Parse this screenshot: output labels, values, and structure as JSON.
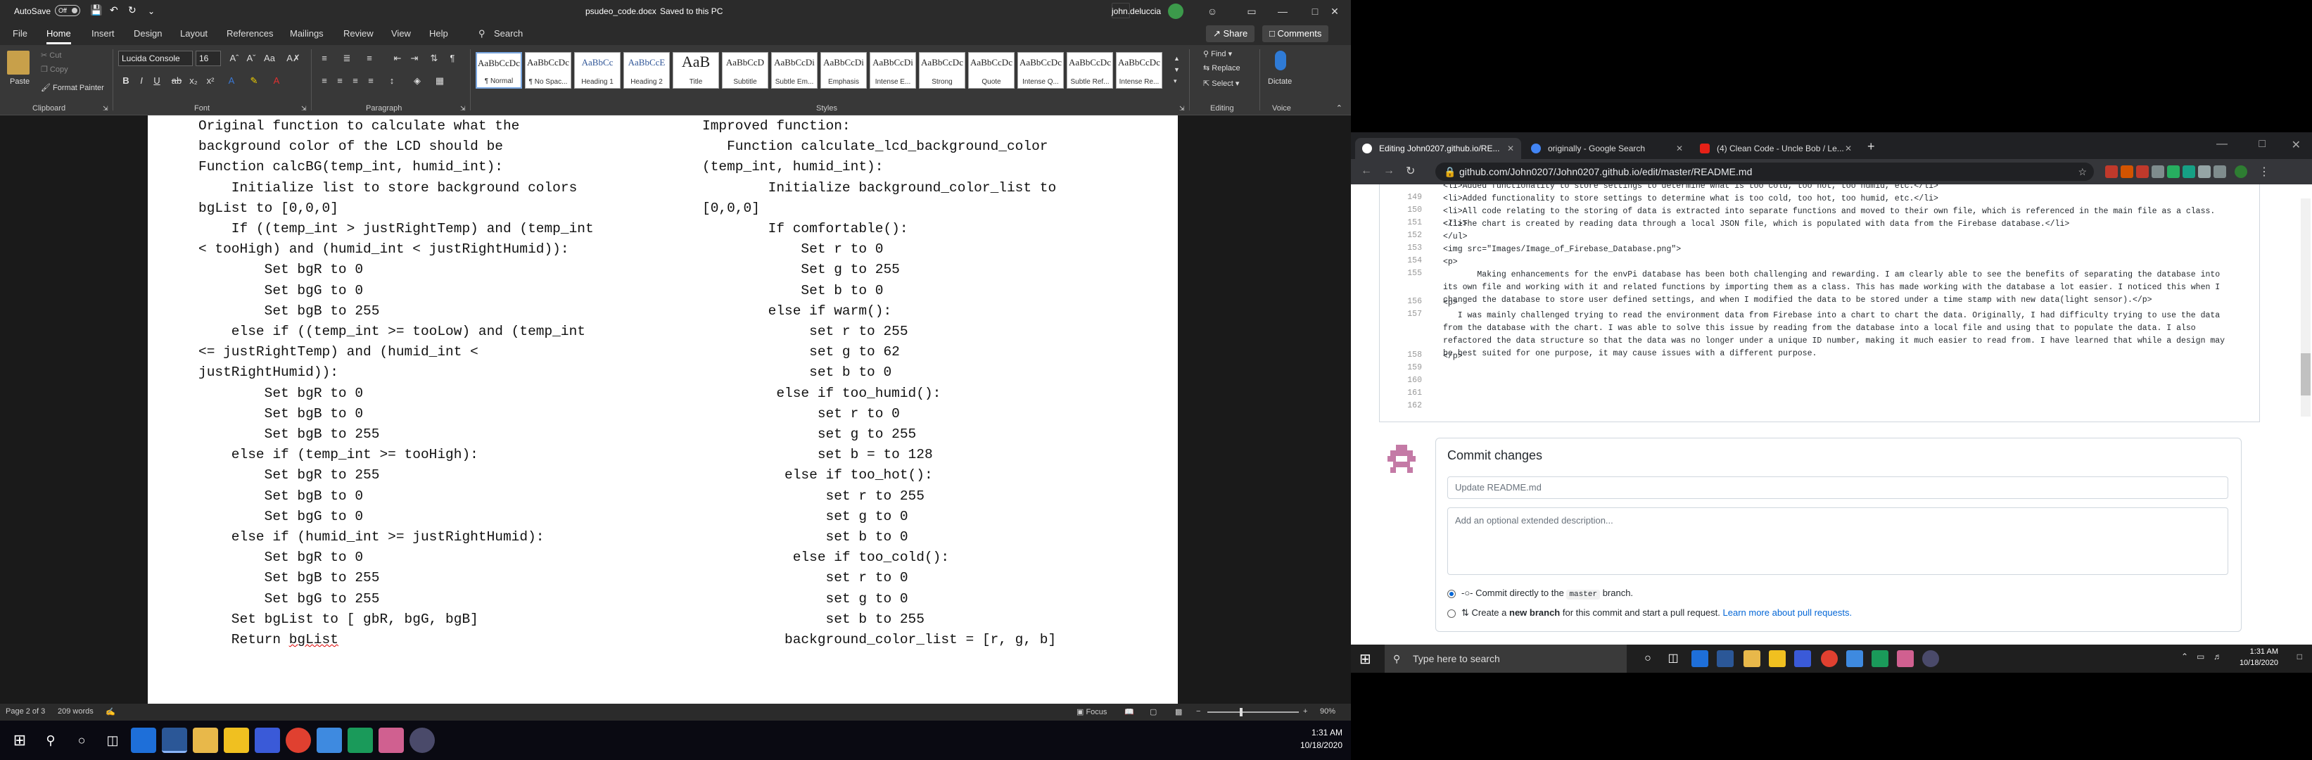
{
  "word": {
    "title_bar": {
      "autosave_label": "AutoSave",
      "autosave_state": "Off",
      "doc_title": "psudeo_code.docx",
      "saved_status": "Saved to this PC",
      "user_name": "john.deluccia"
    },
    "tabs": [
      "File",
      "Home",
      "Insert",
      "Design",
      "Layout",
      "References",
      "Mailings",
      "Review",
      "View",
      "Help"
    ],
    "search_label": "Search",
    "share_label": "Share",
    "comments_label": "Comments",
    "ribbon": {
      "paste_label": "Paste",
      "cut_label": "Cut",
      "copy_label": "Copy",
      "format_painter_label": "Format Painter",
      "font_name": "Lucida Console",
      "font_size": "16",
      "styles": [
        {
          "preview": "AaBbCcDc",
          "name": "¶ Normal"
        },
        {
          "preview": "AaBbCcDc",
          "name": "¶ No Spac..."
        },
        {
          "preview": "AaBbCc",
          "name": "Heading 1"
        },
        {
          "preview": "AaBbCcE",
          "name": "Heading 2"
        },
        {
          "preview": "AaB",
          "name": "Title"
        },
        {
          "preview": "AaBbCcD",
          "name": "Subtitle"
        },
        {
          "preview": "AaBbCcDi",
          "name": "Subtle Em..."
        },
        {
          "preview": "AaBbCcDi",
          "name": "Emphasis"
        },
        {
          "preview": "AaBbCcDi",
          "name": "Intense E..."
        },
        {
          "preview": "AaBbCcDc",
          "name": "Strong"
        },
        {
          "preview": "AaBbCcDc",
          "name": "Quote"
        },
        {
          "preview": "AaBbCcDc",
          "name": "Intense Q..."
        },
        {
          "preview": "AaBbCcDc",
          "name": "Subtle Ref..."
        },
        {
          "preview": "AaBbCcDc",
          "name": "Intense Re..."
        }
      ],
      "find_label": "Find",
      "replace_label": "Replace",
      "select_label": "Select",
      "dictate_label": "Dictate",
      "groups": {
        "clipboard": "Clipboard",
        "font": "Font",
        "paragraph": "Paragraph",
        "styles": "Styles",
        "editing": "Editing",
        "voice": "Voice"
      }
    },
    "page_left": [
      "Original function to calculate what the",
      "background color of the LCD should be",
      "Function calcBG(temp_int, humid_int):",
      "    Initialize list to store background colors",
      "bgList to [0,0,0]",
      "    If ((temp_int > justRightTemp) and (temp_int",
      "< tooHigh) and (humid_int < justRightHumid)):",
      "        Set bgR to 0",
      "        Set bgG to 0",
      "        Set bgB to 255",
      "    else if ((temp_int >= tooLow) and (temp_int",
      "<= justRightTemp) and (humid_int <",
      "justRightHumid)):",
      "        Set bgR to 0",
      "        Set bgB to 0",
      "        Set bgB to 255",
      "    else if (temp_int >= tooHigh):",
      "        Set bgR to 255",
      "        Set bgB to 0",
      "        Set bgG to 0",
      "    else if (humid_int >= justRightHumid):",
      "        Set bgR to 0",
      "        Set bgB to 255",
      "        Set bgG to 255",
      "    Set bgList to [ gbR, bgG, bgB]",
      "    Return ",
      "bgList"
    ],
    "page_right": [
      "Improved function:",
      "   Function calculate_lcd_background_color",
      "(temp_int, humid_int):",
      "        Initialize background_color_list to",
      "[0,0,0]",
      "        If comfortable():",
      "            Set r to 0",
      "            Set g to 255",
      "            Set b to 0",
      "        else if warm():",
      "             set r to 255",
      "             set g to 62",
      "             set b to 0",
      "         else if too_humid():",
      "              set r to 0",
      "              set g to 255",
      "              set b = to 128",
      "          else if too_hot():",
      "               set r to 255",
      "               set g to 0",
      "               set b to 0",
      "           else if too_cold():",
      "               set r to 0",
      "               set g to 0",
      "               set b to 255",
      "          background_color_list = [r, g, b]"
    ],
    "status": {
      "page": "Page 2 of 3",
      "words": "209 words",
      "focus": "Focus",
      "zoom": "90%"
    },
    "taskbar_time": "1:31 AM",
    "taskbar_date": "10/18/2020"
  },
  "browser": {
    "tabs": [
      {
        "label": "Editing John0207.github.io/RE...",
        "active": true
      },
      {
        "label": "originally - Google Search",
        "active": false
      },
      {
        "label": "(4) Clean Code - Uncle Bob / Le...",
        "active": false
      }
    ],
    "url": "github.com/John0207/John0207.github.io/edit/master/README.md",
    "editor_lines": [
      {
        "n": "",
        "t": "<li>Added functionality to store settings to determine what is too cold, too hot, too humid, etc.</li>"
      },
      {
        "n": "149",
        "t": "<li>Added functionality to store settings to determine what is too cold, too hot, too humid, etc.</li>"
      },
      {
        "n": "150",
        "t": "<li>All code relating to the storing of data is extracted into separate functions and moved to their own file, which is referenced in the main file as a class.</li>"
      },
      {
        "n": "151",
        "t": "<li>The chart is created by reading data through a local JSON file, which is populated with data from the Firebase database.</li>"
      },
      {
        "n": "152",
        "t": "</ul>"
      },
      {
        "n": "153",
        "t": "<img src=\"Images/Image_of_Firebase_Database.png\">"
      },
      {
        "n": "154",
        "t": "<p>"
      },
      {
        "n": "155",
        "t": "       Making enhancements for the envPi database has been both challenging and rewarding. I am clearly able to see the benefits of separating the database into its own file and working with it and related functions by importing them as a class. This has made working with the database a lot easier. I noticed this when I changed the database to store user defined settings, and when I modified the data to be stored under a time stamp with new data(light sensor).</p>"
      },
      {
        "n": "156",
        "t": "<p>"
      },
      {
        "n": "157",
        "t": "   I was mainly challenged trying to read the environment data from Firebase into a chart to chart the data. Originally, I had difficulty trying to use the data from the database with the chart. I was able to solve this issue by reading from the database into a local file and using that to populate the data. I also refactored the data structure so that the data was no longer under a unique ID number, making it much easier to read from. I have learned that while a design may be best suited for one purpose, it may cause issues with a different purpose."
      },
      {
        "n": "158",
        "t": "</p>"
      },
      {
        "n": "159",
        "t": ""
      },
      {
        "n": "160",
        "t": ""
      },
      {
        "n": "161",
        "t": ""
      },
      {
        "n": "162",
        "t": ""
      }
    ],
    "commit": {
      "heading": "Commit changes",
      "summary_placeholder": "Update README.md",
      "description_placeholder": "Add an optional extended description...",
      "option1_pre": "Commit directly to the",
      "option1_branch": "master",
      "option1_post": "branch.",
      "option2_pre": "Create a",
      "option2_bold": "new branch",
      "option2_post": "for this commit and start a pull request.",
      "option2_link": "Learn more about pull requests."
    }
  },
  "right_taskbar": {
    "search_placeholder": "Type here to search",
    "time": "1:31 AM",
    "date": "10/18/2020"
  }
}
